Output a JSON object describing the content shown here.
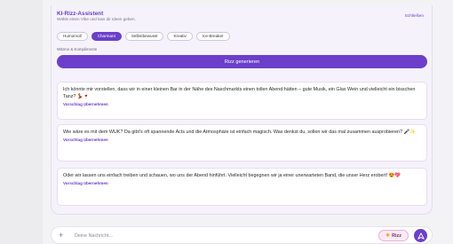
{
  "assistant": {
    "title": "KI-Rizz-Assistent",
    "subtitle": "Wähle einen Vibe und lass dir Ideen geben.",
    "close_label": "Schließen",
    "vibes": [
      "Humorvoll",
      "Charmant",
      "Selbstbewusst",
      "Kreativ",
      "Ice-Breaker"
    ],
    "active_vibe": "Charmant",
    "hint": "Wärme & Komplimente",
    "generate_label": "Rizz generieren",
    "use_label": "Vorschlag übernehmen",
    "suggestions": [
      "Ich könnte mir vorstellen, dass wir in einer kleinen Bar in der Nähe des Naschmarkts einen tollen Abend hätten – gute Musik, ein Glas Wein und vielleicht ein bisschen Tanz? 💃🍷",
      "Wie wäre es mit dem WUK? Da gibt's oft spannende Acts und die Atmosphäre ist einfach magisch. Was denkst du, sollen wir das mal zusammen ausprobieren? 🎤✨",
      "Oder wir lassen uns einfach treiben und schauen, wo uns der Abend hinführt. Vielleicht begegnen wir ja einer unerwarteten Band, die unser Herz erobert! 😍💖"
    ]
  },
  "composer": {
    "placeholder": "Deine Nachricht…",
    "rizz_label": "Rizz",
    "send_icon": "send-icon"
  },
  "colors": {
    "accent": "#6b3fc9",
    "panel_bg": "#f5f2fb",
    "rizz_bg": "#fbeaf5"
  }
}
